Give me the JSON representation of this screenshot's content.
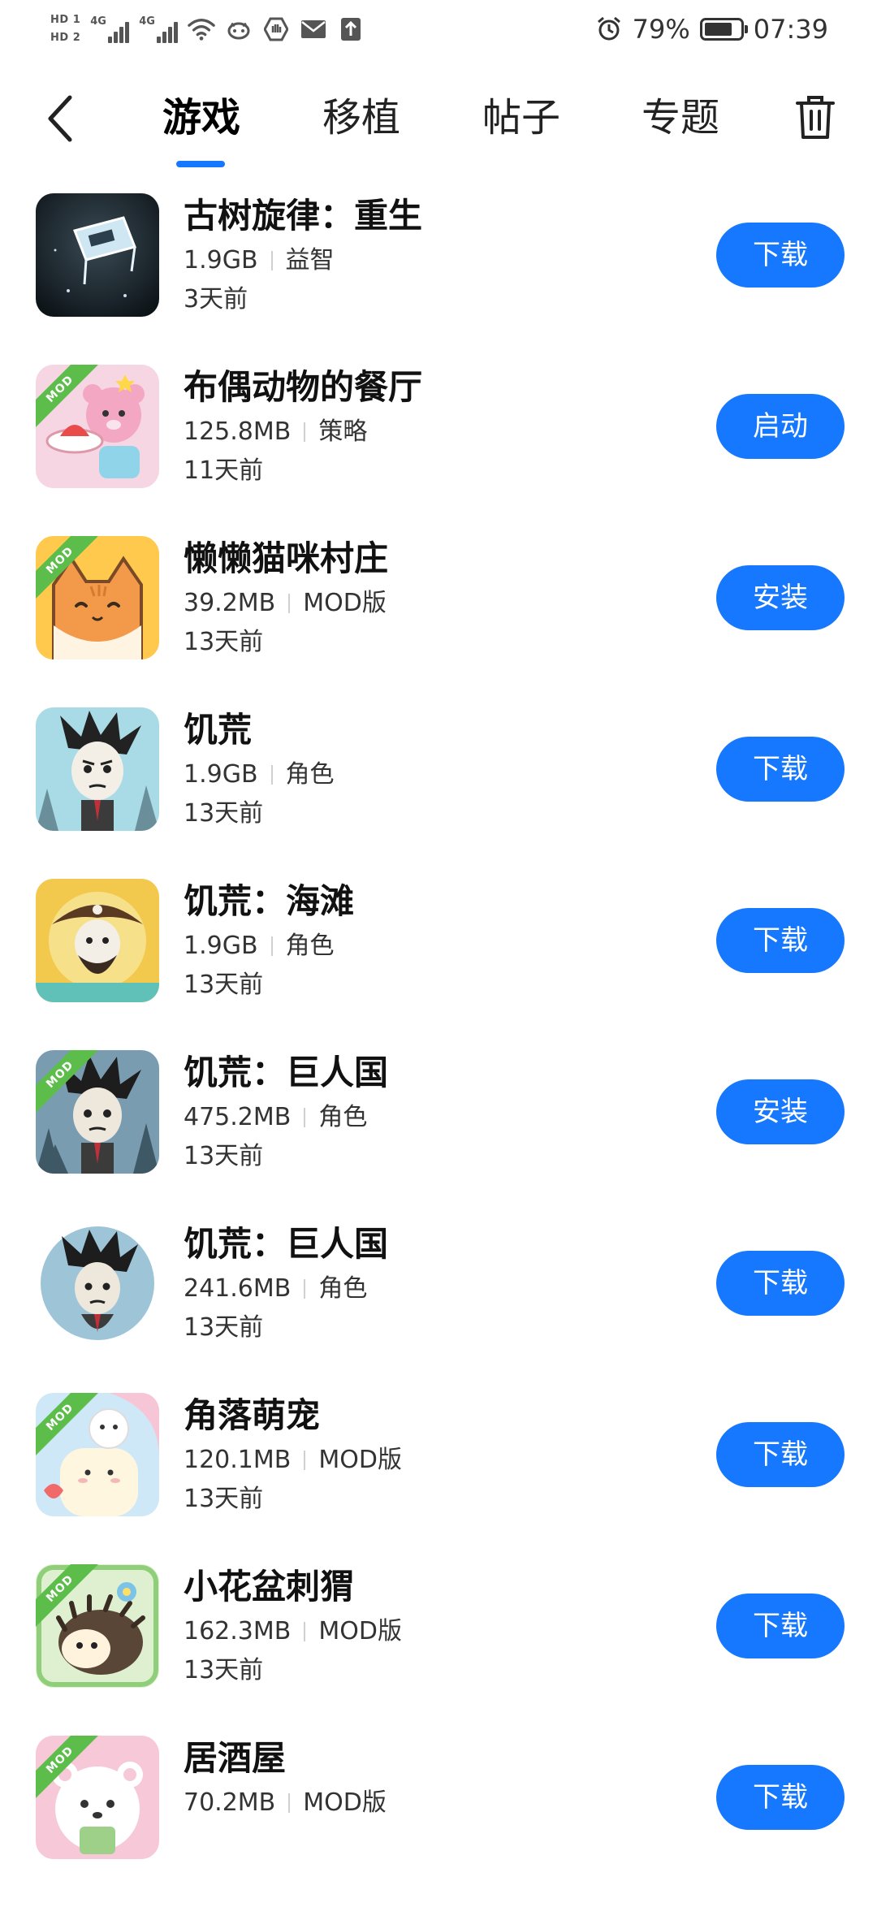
{
  "status_bar": {
    "sim1_label": "HD 1",
    "sim2_label": "HD 2",
    "network1": "4G",
    "network2": "4G",
    "battery_level": 0.79,
    "battery_text": "79%",
    "time": "07:39"
  },
  "header": {
    "tabs": [
      {
        "label": "游戏",
        "active": true
      },
      {
        "label": "移植",
        "active": false
      },
      {
        "label": "帖子",
        "active": false
      },
      {
        "label": "专题",
        "active": false
      }
    ],
    "accent_color": "#1677ff"
  },
  "apps": [
    {
      "title": "古树旋律：重生",
      "size": "1.9GB",
      "tag": "益智",
      "time": "3天前",
      "action": "下载",
      "mod": false,
      "icon": "ancient-tree-icon"
    },
    {
      "title": "布偶动物的餐厅",
      "size": "125.8MB",
      "tag": "策略",
      "time": "11天前",
      "action": "启动",
      "mod": true,
      "icon": "bear-chef-icon"
    },
    {
      "title": "懒懒猫咪村庄",
      "size": "39.2MB",
      "tag": "MOD版",
      "time": "13天前",
      "action": "安装",
      "mod": true,
      "icon": "orange-cat-icon"
    },
    {
      "title": "饥荒",
      "size": "1.9GB",
      "tag": "角色",
      "time": "13天前",
      "action": "下载",
      "mod": false,
      "icon": "dont-starve-icon"
    },
    {
      "title": "饥荒：海滩",
      "size": "1.9GB",
      "tag": "角色",
      "time": "13天前",
      "action": "下载",
      "mod": false,
      "icon": "pirate-icon"
    },
    {
      "title": "饥荒：巨人国",
      "size": "475.2MB",
      "tag": "角色",
      "time": "13天前",
      "action": "安装",
      "mod": true,
      "icon": "dont-starve-giants-icon"
    },
    {
      "title": "饥荒：巨人国",
      "size": "241.6MB",
      "tag": "角色",
      "time": "13天前",
      "action": "下载",
      "mod": false,
      "icon": "dont-starve-giants-round-icon"
    },
    {
      "title": "角落萌宠",
      "size": "120.1MB",
      "tag": "MOD版",
      "time": "13天前",
      "action": "下载",
      "mod": true,
      "icon": "sumikko-icon"
    },
    {
      "title": "小花盆刺猬",
      "size": "162.3MB",
      "tag": "MOD版",
      "time": "13天前",
      "action": "下载",
      "mod": true,
      "icon": "hedgehog-icon"
    },
    {
      "title": "居酒屋",
      "size": "70.2MB",
      "tag": "MOD版",
      "time": "",
      "action": "下载",
      "mod": true,
      "icon": "polar-bear-icon"
    }
  ],
  "mod_badge_text": "MOD"
}
